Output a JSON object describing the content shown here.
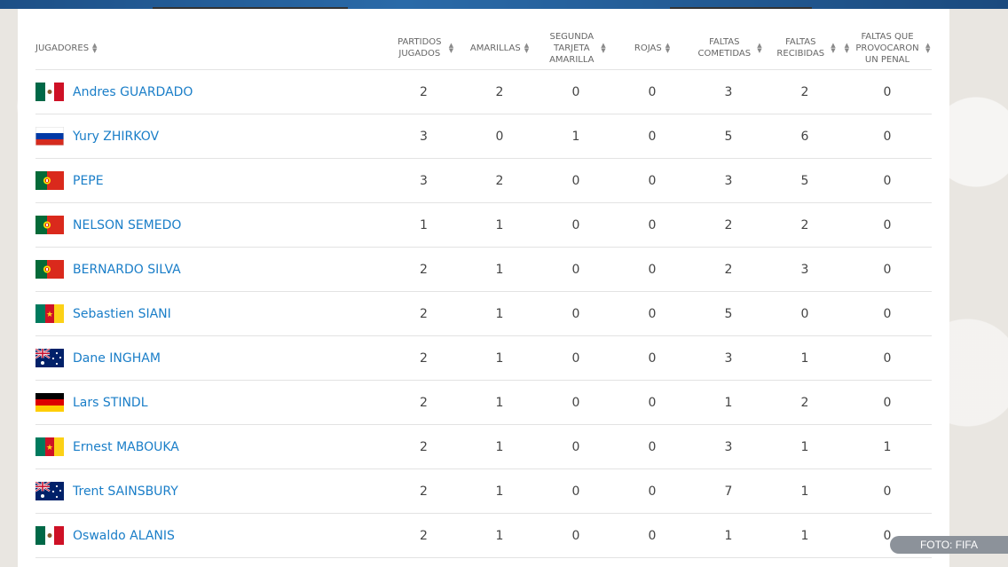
{
  "table": {
    "headers": {
      "player": "JUGADORES",
      "played": "PARTIDOS JUGADOS",
      "yellow": "AMARILLAS",
      "second_yellow": "SEGUNDA TARJETA AMARILLA",
      "red": "ROJAS",
      "fouls_committed": "FALTAS COMETIDAS",
      "fouls_received": "FALTAS RECIBIDAS",
      "penalty_fouls": "FALTAS QUE PROVOCARON UN PENAL"
    },
    "rows": [
      {
        "flag": "mexico-flag",
        "name": "Andres GUARDADO",
        "played": "2",
        "yellow": "2",
        "second_yellow": "0",
        "red": "0",
        "fouls_committed": "3",
        "fouls_received": "2",
        "penalty_fouls": "0"
      },
      {
        "flag": "russia-flag",
        "name": "Yury ZHIRKOV",
        "played": "3",
        "yellow": "0",
        "second_yellow": "1",
        "red": "0",
        "fouls_committed": "5",
        "fouls_received": "6",
        "penalty_fouls": "0"
      },
      {
        "flag": "portugal-flag",
        "name": "PEPE",
        "played": "3",
        "yellow": "2",
        "second_yellow": "0",
        "red": "0",
        "fouls_committed": "3",
        "fouls_received": "5",
        "penalty_fouls": "0"
      },
      {
        "flag": "portugal-flag",
        "name": "NELSON SEMEDO",
        "played": "1",
        "yellow": "1",
        "second_yellow": "0",
        "red": "0",
        "fouls_committed": "2",
        "fouls_received": "2",
        "penalty_fouls": "0"
      },
      {
        "flag": "portugal-flag",
        "name": "BERNARDO SILVA",
        "played": "2",
        "yellow": "1",
        "second_yellow": "0",
        "red": "0",
        "fouls_committed": "2",
        "fouls_received": "3",
        "penalty_fouls": "0"
      },
      {
        "flag": "cameroon-flag",
        "name": "Sebastien SIANI",
        "played": "2",
        "yellow": "1",
        "second_yellow": "0",
        "red": "0",
        "fouls_committed": "5",
        "fouls_received": "0",
        "penalty_fouls": "0"
      },
      {
        "flag": "australia-flag",
        "name": "Dane INGHAM",
        "played": "2",
        "yellow": "1",
        "second_yellow": "0",
        "red": "0",
        "fouls_committed": "3",
        "fouls_received": "1",
        "penalty_fouls": "0"
      },
      {
        "flag": "germany-flag",
        "name": "Lars STINDL",
        "played": "2",
        "yellow": "1",
        "second_yellow": "0",
        "red": "0",
        "fouls_committed": "1",
        "fouls_received": "2",
        "penalty_fouls": "0"
      },
      {
        "flag": "cameroon-flag",
        "name": "Ernest MABOUKA",
        "played": "2",
        "yellow": "1",
        "second_yellow": "0",
        "red": "0",
        "fouls_committed": "3",
        "fouls_received": "1",
        "penalty_fouls": "1"
      },
      {
        "flag": "australia-flag",
        "name": "Trent SAINSBURY",
        "played": "2",
        "yellow": "1",
        "second_yellow": "0",
        "red": "0",
        "fouls_committed": "7",
        "fouls_received": "1",
        "penalty_fouls": "0"
      },
      {
        "flag": "mexico-flag",
        "name": "Oswaldo ALANIS",
        "played": "2",
        "yellow": "1",
        "second_yellow": "0",
        "red": "0",
        "fouls_committed": "1",
        "fouls_received": "1",
        "penalty_fouls": "0"
      }
    ]
  },
  "photo_credit": "FOTO: FIFA",
  "colors": {
    "link": "#1a7ec8",
    "header_text": "#666666",
    "divider": "#e3e3e3",
    "credit_bg": "#8c929a"
  }
}
